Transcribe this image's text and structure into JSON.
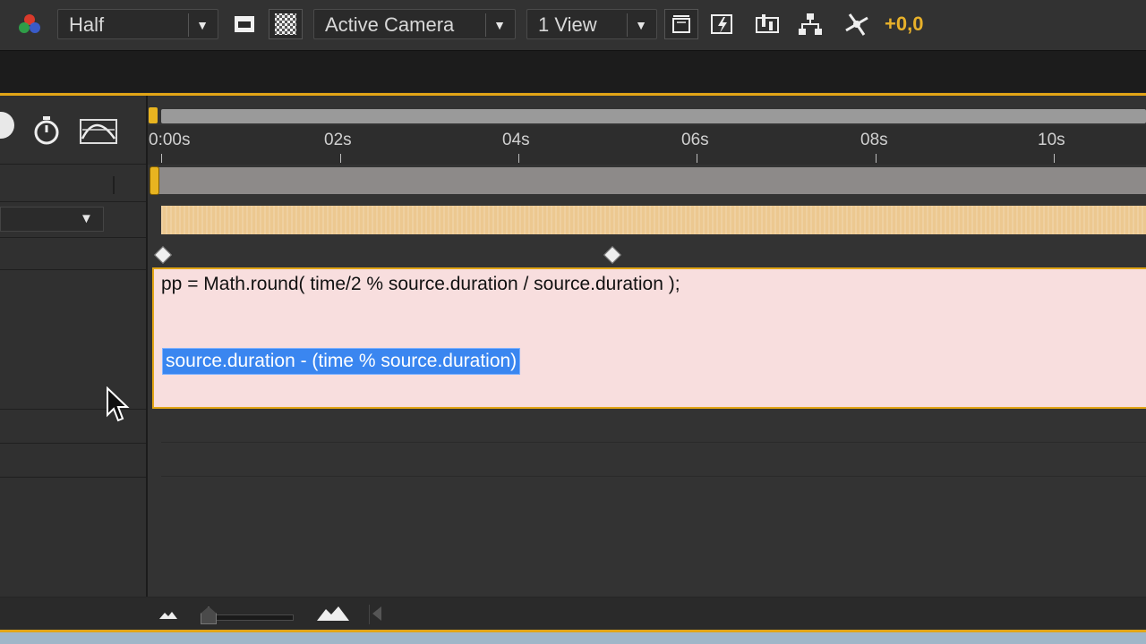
{
  "toolbar": {
    "resolution": "Half",
    "camera": "Active Camera",
    "view_layout": "1 View",
    "exposure": "+0,0",
    "icons": [
      "color-channels-icon",
      "region-of-interest-icon",
      "transparency-grid-icon",
      "3d-view-icon",
      "fast-previews-icon",
      "timeline-icon",
      "comp-flowchart-icon",
      "reset-exposure-icon"
    ]
  },
  "timeline": {
    "ruler_labels": [
      "0:00s",
      "02s",
      "04s",
      "06s",
      "08s",
      "10s"
    ],
    "expression": {
      "line1": "pp = Math.round( time/2 % source.duration / source.duration );",
      "line2_selected": "source.duration - (time % source.duration)"
    }
  },
  "colors": {
    "accent": "#e2a516",
    "selection": "#3a86f0",
    "expression_bg": "#f8dede",
    "layer_bar": "#ecc890"
  }
}
